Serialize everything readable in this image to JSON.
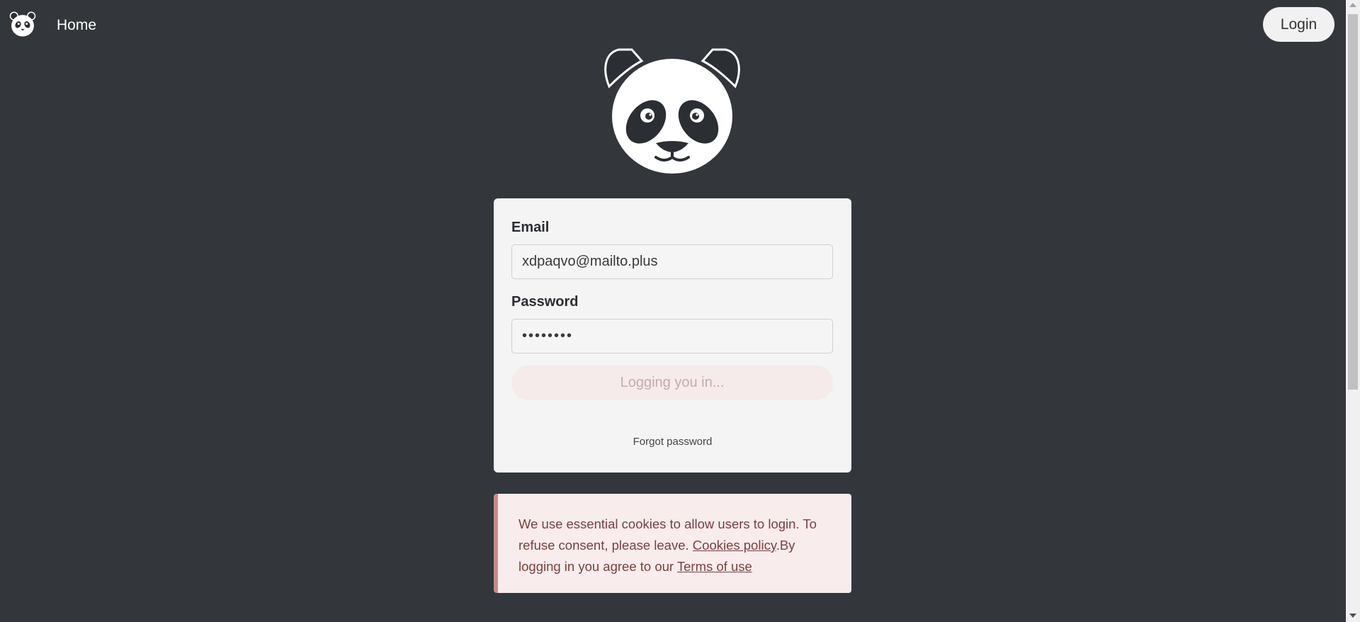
{
  "nav": {
    "logo_icon": "panda-icon",
    "home_label": "Home",
    "login_label": "Login"
  },
  "hero": {
    "icon": "panda-icon"
  },
  "form": {
    "email_label": "Email",
    "email_value": "xdpaqvo@mailto.plus",
    "password_label": "Password",
    "password_value": "••••••••",
    "submit_label": "Logging you in...",
    "forgot_label": "Forgot password"
  },
  "notice": {
    "text_1": "We use essential cookies to allow users to login. To refuse consent, please leave. ",
    "cookies_link": "Cookies policy",
    "text_2": ".By logging in you agree to our ",
    "terms_link": "Terms of use"
  },
  "colors": {
    "background": "#33363b",
    "card": "#f4f4f4",
    "notice_bg": "#f8ecec",
    "notice_border": "#c98a8a",
    "notice_text": "#7b3f3f"
  }
}
